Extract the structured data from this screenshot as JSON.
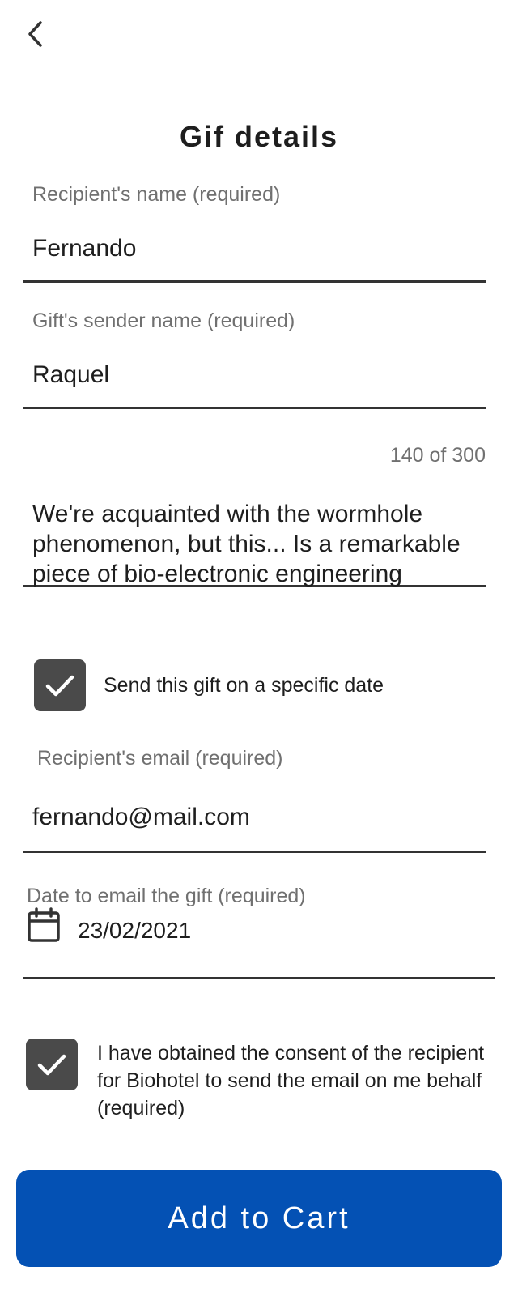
{
  "header": {
    "back_icon": "chevron-left-icon"
  },
  "title": "Gif details",
  "recipient_name": {
    "label": "Recipient's name (required)",
    "value": "Fernando"
  },
  "sender_name": {
    "label": "Gift's sender name (required)",
    "value": "Raquel"
  },
  "message": {
    "counter": "140 of 300",
    "value": "We're acquainted with the wormhole phenomenon, but this... Is a remarkable piece of bio-electronic engineering"
  },
  "specific_date": {
    "checked": true,
    "label": "Send this gift on a specific date"
  },
  "recipient_email": {
    "label": "Recipient's email (required)",
    "value": "fernando@mail.com"
  },
  "email_date": {
    "label": "Date to email the gift (required)",
    "value": "23/02/2021",
    "icon": "calendar-icon"
  },
  "consent": {
    "checked": true,
    "label": "I have obtained the consent of the recipient for Biohotel to send the email on me behalf (required)"
  },
  "add_to_cart": {
    "label": "Add to Cart",
    "color": "#0451b4"
  }
}
